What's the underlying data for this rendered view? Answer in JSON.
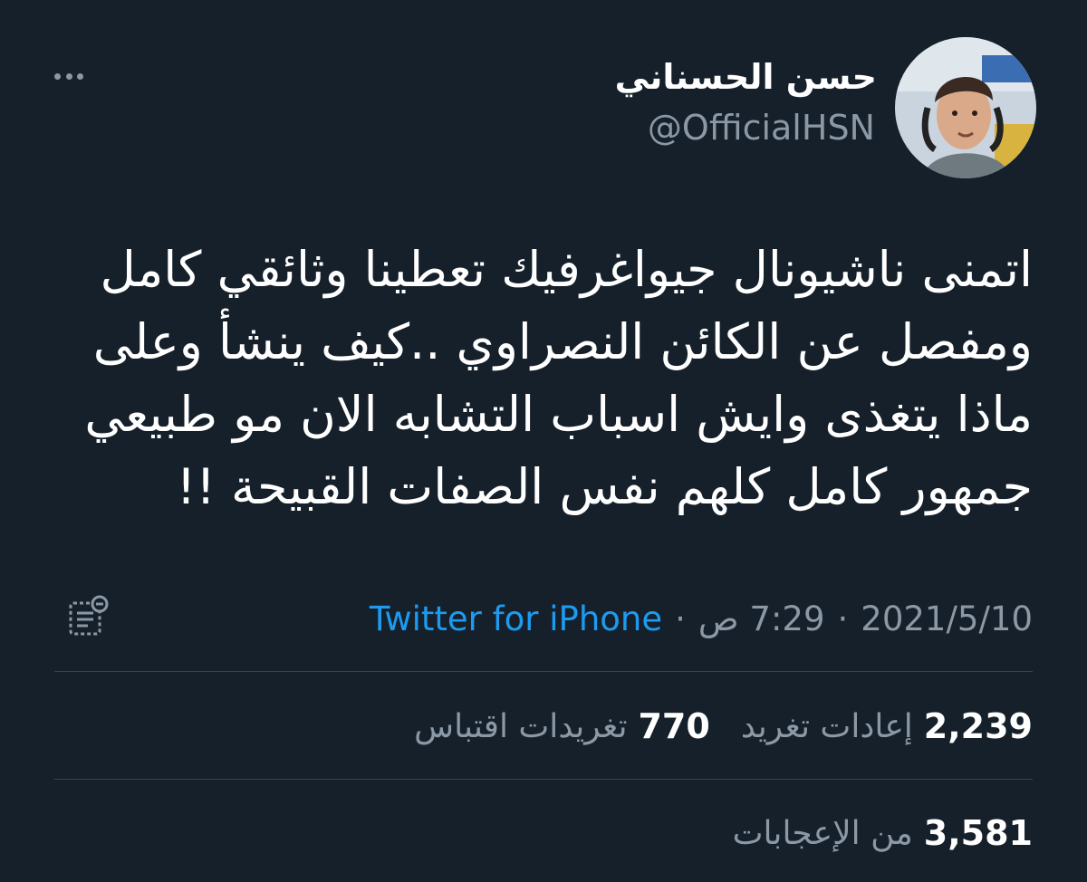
{
  "tweet": {
    "author": {
      "display_name": "حسن الحسناني",
      "handle": "@OfficialHSN"
    },
    "text_lines": [
      "اتمنى ناشيونال جيواغرفيك تعطينا وثائقي كامل",
      "ومفصل عن الكائن النصراوي ..كيف ينشأ وعلى",
      "ماذا يتغذى وايش اسباب التشابه الان مو طبيعي",
      "جمهور كامل كلهم نفس الصفات القبيحة !!"
    ],
    "meta": {
      "source": "Twitter for iPhone",
      "separator": "·",
      "time": "7:29 ص",
      "date": "2021/5/10"
    },
    "stats": {
      "retweets_count": "2,239",
      "retweets_label": "إعادات تغريد",
      "quotes_count": "770",
      "quotes_label": "تغريدات اقتباس",
      "likes_count": "3,581",
      "likes_label": "من الإعجابات"
    }
  },
  "icons": {
    "more": "more-icon",
    "analytics": "analytics-icon"
  },
  "colors": {
    "background": "#15202b",
    "link": "#1d9bf0",
    "secondary_text": "#8b98a5",
    "divider": "#38444d"
  }
}
